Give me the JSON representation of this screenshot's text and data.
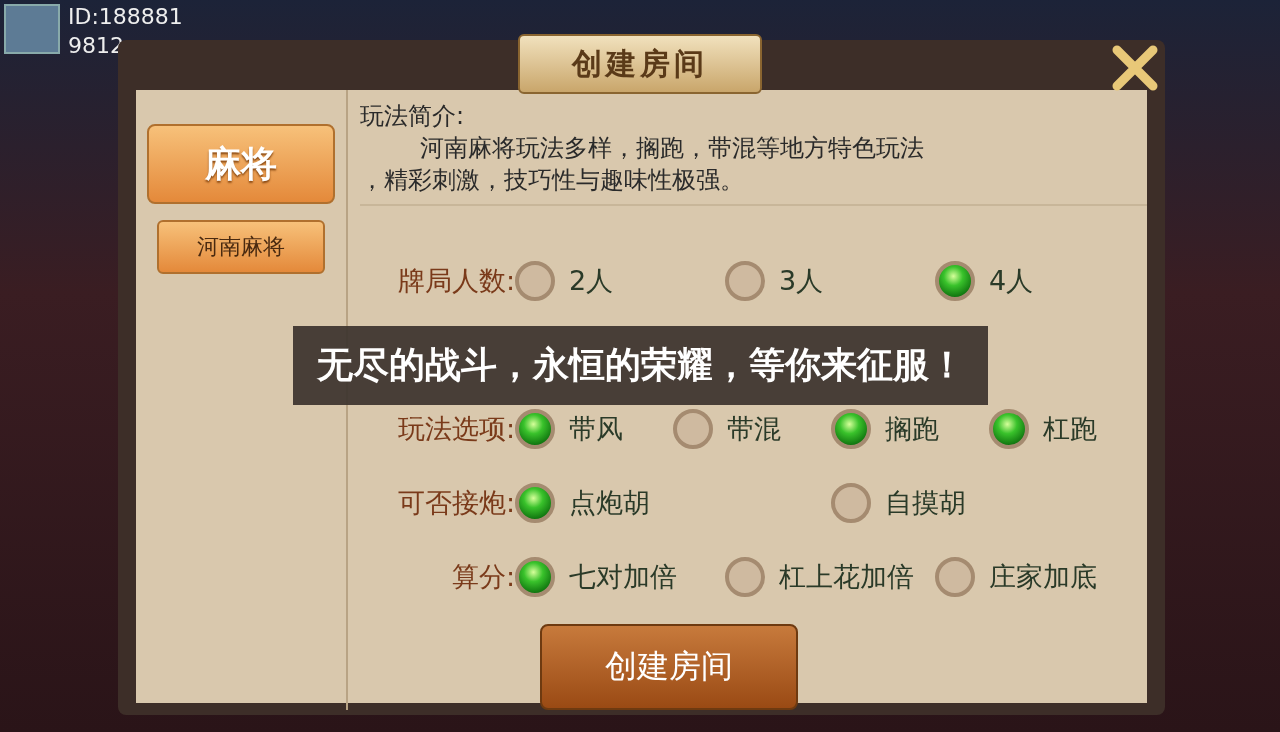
{
  "player": {
    "id": "ID:188881",
    "number": "9812"
  },
  "dialog": {
    "title": "创建房间",
    "categories": [
      {
        "label": "麻将",
        "selected": true
      }
    ],
    "games": [
      {
        "label": "河南麻将",
        "selected": true
      }
    ],
    "intro": {
      "heading": "玩法简介:",
      "text": "河南麻将玩法多样，搁跑，带混等地方特色玩法",
      "text_cont": "，精彩刺激，技巧性与趣味性极强。"
    },
    "rows": [
      {
        "label": "牌局人数:",
        "options": [
          {
            "label": "2人",
            "selected": false
          },
          {
            "label": "3人",
            "selected": false
          },
          {
            "label": "4人",
            "selected": true
          }
        ]
      },
      {
        "label": "",
        "options": []
      },
      {
        "label": "玩法选项:",
        "options": [
          {
            "label": "带风",
            "selected": true
          },
          {
            "label": "带混",
            "selected": false
          },
          {
            "label": "搁跑",
            "selected": true
          },
          {
            "label": "杠跑",
            "selected": true
          }
        ]
      },
      {
        "label": "可否接炮:",
        "options": [
          {
            "label": "点炮胡",
            "selected": true
          },
          {
            "label": "自摸胡",
            "selected": false
          }
        ]
      },
      {
        "label": "算分:",
        "options": [
          {
            "label": "七对加倍",
            "selected": true
          },
          {
            "label": "杠上花加倍",
            "selected": false
          },
          {
            "label": "庄家加底",
            "selected": false
          }
        ]
      }
    ],
    "create_button": "创建房间"
  },
  "banner": "无尽的战斗，永恒的荣耀，等你来征服！"
}
